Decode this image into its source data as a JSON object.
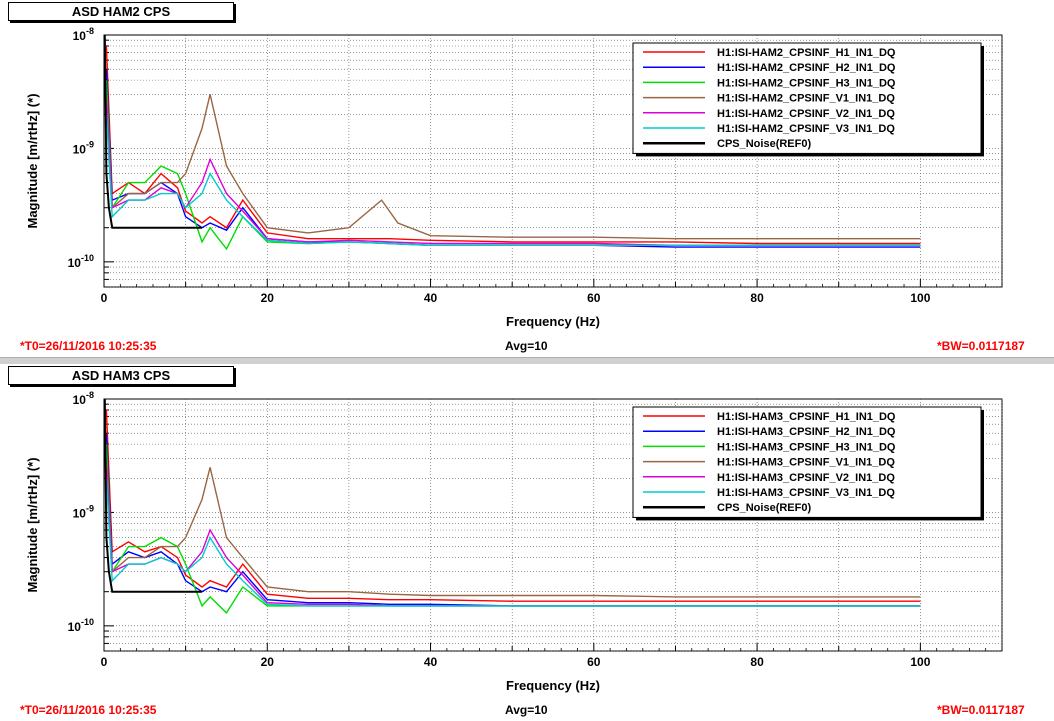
{
  "chart_data": [
    {
      "type": "line",
      "title": "ASD HAM2 CPS",
      "xlabel": "Frequency (Hz)",
      "ylabel": "Magnitude [m/rtHz] (*)",
      "xlim": [
        0,
        110
      ],
      "ylim": [
        6e-11,
        1e-08
      ],
      "yscale": "log",
      "grid": true,
      "legend_position": "top-right",
      "x_ticks": [
        "0",
        "20",
        "40",
        "60",
        "80",
        "100"
      ],
      "y_ticks": [
        {
          "base": "10",
          "exp": "-8",
          "value": 1e-08
        },
        {
          "base": "10",
          "exp": "-9",
          "value": 1e-09
        },
        {
          "base": "10",
          "exp": "-10",
          "value": 1e-10
        }
      ],
      "footer": {
        "t0": "*T0=26/11/2016 10:25:35",
        "avg": "Avg=10",
        "bw": "*BW=0.0117187"
      },
      "series": [
        {
          "name": "H1:ISI-HAM2_CPSINF_H1_IN1_DQ",
          "color": "#ff0000",
          "x": [
            0.3,
            1,
            3,
            5,
            7,
            9,
            10,
            12,
            13,
            15,
            17,
            20,
            25,
            30,
            35,
            40,
            50,
            60,
            70,
            80,
            90,
            100
          ],
          "y": [
            8e-09,
            4e-10,
            5e-10,
            4e-10,
            6e-10,
            4.5e-10,
            2.8e-10,
            2.2e-10,
            2.5e-10,
            2e-10,
            3.5e-10,
            1.8e-10,
            1.6e-10,
            1.6e-10,
            1.6e-10,
            1.55e-10,
            1.5e-10,
            1.5e-10,
            1.5e-10,
            1.45e-10,
            1.45e-10,
            1.45e-10
          ]
        },
        {
          "name": "H1:ISI-HAM2_CPSINF_H2_IN1_DQ",
          "color": "#0000ff",
          "x": [
            0.3,
            1,
            3,
            5,
            7,
            9,
            10,
            12,
            13,
            15,
            17,
            20,
            25,
            30,
            35,
            40,
            50,
            60,
            70,
            80,
            90,
            100
          ],
          "y": [
            5e-09,
            3.5e-10,
            4e-10,
            4e-10,
            5e-10,
            4e-10,
            2.5e-10,
            2e-10,
            2.2e-10,
            1.9e-10,
            3e-10,
            1.6e-10,
            1.5e-10,
            1.5e-10,
            1.45e-10,
            1.4e-10,
            1.4e-10,
            1.4e-10,
            1.35e-10,
            1.35e-10,
            1.35e-10,
            1.35e-10
          ]
        },
        {
          "name": "H1:ISI-HAM2_CPSINF_H3_IN1_DQ",
          "color": "#00dd00",
          "x": [
            0.3,
            1,
            3,
            5,
            7,
            9,
            10,
            12,
            13,
            15,
            17,
            20,
            25,
            30,
            35,
            40,
            50,
            60,
            70,
            80,
            90,
            100
          ],
          "y": [
            4e-09,
            3e-10,
            5e-10,
            5e-10,
            7e-10,
            6e-10,
            4e-10,
            1.5e-10,
            2e-10,
            1.3e-10,
            2.5e-10,
            1.5e-10,
            1.45e-10,
            1.5e-10,
            1.45e-10,
            1.4e-10,
            1.4e-10,
            1.4e-10,
            1.4e-10,
            1.4e-10,
            1.4e-10,
            1.4e-10
          ]
        },
        {
          "name": "H1:ISI-HAM2_CPSINF_V1_IN1_DQ",
          "color": "#996644",
          "x": [
            0.3,
            1,
            3,
            5,
            7,
            9,
            10,
            12,
            13,
            15,
            17,
            20,
            25,
            30,
            34,
            36,
            40,
            50,
            60,
            70,
            80,
            90,
            100
          ],
          "y": [
            3e-09,
            3e-10,
            4e-10,
            4e-10,
            5e-10,
            5e-10,
            6e-10,
            1.5e-09,
            3e-09,
            7e-10,
            4e-10,
            2e-10,
            1.8e-10,
            2e-10,
            3.5e-10,
            2.2e-10,
            1.7e-10,
            1.65e-10,
            1.65e-10,
            1.6e-10,
            1.6e-10,
            1.6e-10,
            1.6e-10
          ]
        },
        {
          "name": "H1:ISI-HAM2_CPSINF_V2_IN1_DQ",
          "color": "#dd00dd",
          "x": [
            0.3,
            1,
            3,
            5,
            7,
            9,
            10,
            12,
            13,
            15,
            17,
            20,
            25,
            30,
            35,
            40,
            50,
            60,
            70,
            80,
            90,
            100
          ],
          "y": [
            2.5e-09,
            3e-10,
            3.5e-10,
            3.5e-10,
            4.5e-10,
            4e-10,
            3e-10,
            5e-10,
            8e-10,
            4e-10,
            2.8e-10,
            1.6e-10,
            1.5e-10,
            1.55e-10,
            1.5e-10,
            1.45e-10,
            1.45e-10,
            1.45e-10,
            1.4e-10,
            1.4e-10,
            1.4e-10,
            1.4e-10
          ]
        },
        {
          "name": "H1:ISI-HAM2_CPSINF_V3_IN1_DQ",
          "color": "#00cccc",
          "x": [
            0.3,
            1,
            3,
            5,
            7,
            9,
            10,
            12,
            13,
            15,
            17,
            20,
            25,
            30,
            35,
            40,
            50,
            60,
            70,
            80,
            90,
            100
          ],
          "y": [
            2e-09,
            2.5e-10,
            3.5e-10,
            3.5e-10,
            4e-10,
            4e-10,
            3e-10,
            4e-10,
            6e-10,
            3.5e-10,
            2.5e-10,
            1.55e-10,
            1.45e-10,
            1.5e-10,
            1.45e-10,
            1.4e-10,
            1.4e-10,
            1.4e-10,
            1.4e-10,
            1.4e-10,
            1.4e-10,
            1.4e-10
          ]
        },
        {
          "name": "CPS_Noise(REF0)",
          "color": "#000000",
          "x": [
            0,
            0.1,
            0.3,
            0.6,
            1,
            2,
            5,
            10,
            12
          ],
          "y": [
            1e-08,
            1e-08,
            6e-10,
            3e-10,
            2e-10,
            2e-10,
            2e-10,
            2e-10,
            2e-10
          ]
        }
      ]
    },
    {
      "type": "line",
      "title": "ASD HAM3 CPS",
      "xlabel": "Frequency (Hz)",
      "ylabel": "Magnitude [m/rtHz] (*)",
      "xlim": [
        0,
        110
      ],
      "ylim": [
        6e-11,
        1e-08
      ],
      "yscale": "log",
      "grid": true,
      "legend_position": "top-right",
      "x_ticks": [
        "0",
        "20",
        "40",
        "60",
        "80",
        "100"
      ],
      "y_ticks": [
        {
          "base": "10",
          "exp": "-8",
          "value": 1e-08
        },
        {
          "base": "10",
          "exp": "-9",
          "value": 1e-09
        },
        {
          "base": "10",
          "exp": "-10",
          "value": 1e-10
        }
      ],
      "footer": {
        "t0": "*T0=26/11/2016 10:25:35",
        "avg": "Avg=10",
        "bw": "*BW=0.0117187"
      },
      "series": [
        {
          "name": "H1:ISI-HAM3_CPSINF_H1_IN1_DQ",
          "color": "#ff0000",
          "x": [
            0.3,
            1,
            3,
            5,
            7,
            9,
            10,
            12,
            13,
            15,
            17,
            20,
            25,
            30,
            35,
            40,
            50,
            60,
            70,
            80,
            90,
            100
          ],
          "y": [
            8e-09,
            4.5e-10,
            5.5e-10,
            4.5e-10,
            5e-10,
            4e-10,
            2.8e-10,
            2.2e-10,
            2.5e-10,
            2.2e-10,
            3.5e-10,
            1.9e-10,
            1.75e-10,
            1.75e-10,
            1.7e-10,
            1.7e-10,
            1.65e-10,
            1.65e-10,
            1.65e-10,
            1.65e-10,
            1.65e-10,
            1.65e-10
          ]
        },
        {
          "name": "H1:ISI-HAM3_CPSINF_H2_IN1_DQ",
          "color": "#0000ff",
          "x": [
            0.3,
            1,
            3,
            5,
            7,
            9,
            10,
            12,
            13,
            15,
            17,
            20,
            25,
            30,
            35,
            40,
            50,
            60,
            70,
            80,
            90,
            100
          ],
          "y": [
            5e-09,
            3.5e-10,
            4.5e-10,
            4e-10,
            4.5e-10,
            3.5e-10,
            2.5e-10,
            2e-10,
            2.2e-10,
            2e-10,
            3e-10,
            1.7e-10,
            1.6e-10,
            1.6e-10,
            1.55e-10,
            1.55e-10,
            1.5e-10,
            1.5e-10,
            1.5e-10,
            1.5e-10,
            1.5e-10,
            1.5e-10
          ]
        },
        {
          "name": "H1:ISI-HAM3_CPSINF_H3_IN1_DQ",
          "color": "#00dd00",
          "x": [
            0.3,
            1,
            3,
            5,
            7,
            9,
            10,
            12,
            13,
            15,
            17,
            20,
            25,
            30,
            35,
            40,
            50,
            60,
            70,
            80,
            90,
            100
          ],
          "y": [
            4e-09,
            3e-10,
            5e-10,
            5e-10,
            6e-10,
            5e-10,
            3.5e-10,
            1.5e-10,
            1.8e-10,
            1.3e-10,
            2.2e-10,
            1.5e-10,
            1.5e-10,
            1.5e-10,
            1.5e-10,
            1.5e-10,
            1.5e-10,
            1.5e-10,
            1.5e-10,
            1.5e-10,
            1.5e-10,
            1.5e-10
          ]
        },
        {
          "name": "H1:ISI-HAM3_CPSINF_V1_IN1_DQ",
          "color": "#996644",
          "x": [
            0.3,
            1,
            3,
            5,
            7,
            9,
            10,
            12,
            13,
            15,
            17,
            20,
            25,
            30,
            35,
            40,
            50,
            60,
            70,
            80,
            90,
            100
          ],
          "y": [
            3e-09,
            3e-10,
            4e-10,
            4e-10,
            5e-10,
            5e-10,
            6e-10,
            1.3e-09,
            2.5e-09,
            6e-10,
            4e-10,
            2.2e-10,
            2e-10,
            2e-10,
            1.9e-10,
            1.85e-10,
            1.85e-10,
            1.85e-10,
            1.8e-10,
            1.8e-10,
            1.8e-10,
            1.8e-10
          ]
        },
        {
          "name": "H1:ISI-HAM3_CPSINF_V2_IN1_DQ",
          "color": "#dd00dd",
          "x": [
            0.3,
            1,
            3,
            5,
            7,
            9,
            10,
            12,
            13,
            15,
            17,
            20,
            25,
            30,
            35,
            40,
            50,
            60,
            70,
            80,
            90,
            100
          ],
          "y": [
            2.5e-09,
            3e-10,
            3.5e-10,
            3.5e-10,
            4e-10,
            3.5e-10,
            3e-10,
            4.5e-10,
            7e-10,
            4e-10,
            2.8e-10,
            1.6e-10,
            1.55e-10,
            1.55e-10,
            1.5e-10,
            1.5e-10,
            1.5e-10,
            1.5e-10,
            1.5e-10,
            1.5e-10,
            1.5e-10,
            1.5e-10
          ]
        },
        {
          "name": "H1:ISI-HAM3_CPSINF_V3_IN1_DQ",
          "color": "#00cccc",
          "x": [
            0.3,
            1,
            3,
            5,
            7,
            9,
            10,
            12,
            13,
            15,
            17,
            20,
            25,
            30,
            35,
            40,
            50,
            60,
            70,
            80,
            90,
            100
          ],
          "y": [
            2e-09,
            2.5e-10,
            3.5e-10,
            3.5e-10,
            4e-10,
            3.5e-10,
            3e-10,
            4e-10,
            6e-10,
            3.5e-10,
            2.5e-10,
            1.55e-10,
            1.5e-10,
            1.5e-10,
            1.5e-10,
            1.5e-10,
            1.5e-10,
            1.5e-10,
            1.5e-10,
            1.5e-10,
            1.5e-10,
            1.5e-10
          ]
        },
        {
          "name": "CPS_Noise(REF0)",
          "color": "#000000",
          "x": [
            0,
            0.1,
            0.3,
            0.6,
            1,
            2,
            5,
            10,
            12
          ],
          "y": [
            1e-08,
            1e-08,
            6e-10,
            3e-10,
            2e-10,
            2e-10,
            2e-10,
            2e-10,
            2e-10
          ]
        }
      ]
    }
  ]
}
